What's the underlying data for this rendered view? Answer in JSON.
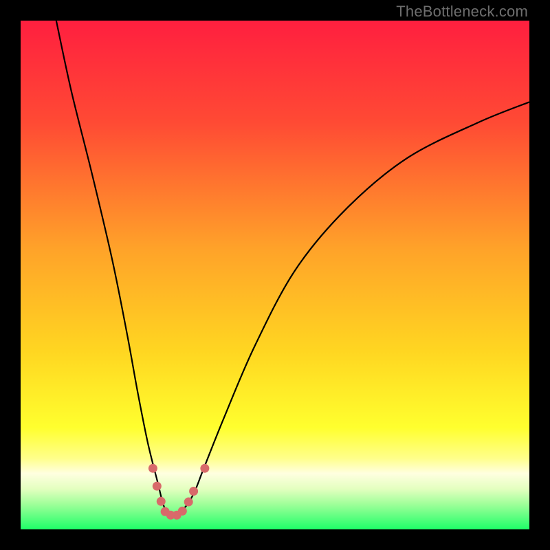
{
  "watermark": "TheBottleneck.com",
  "chart_data": {
    "type": "line",
    "title": "",
    "xlabel": "",
    "ylabel": "",
    "xlim": [
      0,
      100
    ],
    "ylim": [
      0,
      100
    ],
    "grid": false,
    "legend": false,
    "gradient_stops": [
      {
        "offset": 0.0,
        "color": "#ff1f3f"
      },
      {
        "offset": 0.2,
        "color": "#ff4a34"
      },
      {
        "offset": 0.45,
        "color": "#ffa329"
      },
      {
        "offset": 0.65,
        "color": "#ffd621"
      },
      {
        "offset": 0.8,
        "color": "#ffff2e"
      },
      {
        "offset": 0.86,
        "color": "#ffff8a"
      },
      {
        "offset": 0.89,
        "color": "#ffffe0"
      },
      {
        "offset": 0.92,
        "color": "#e4ffc0"
      },
      {
        "offset": 0.95,
        "color": "#a0ff9a"
      },
      {
        "offset": 1.0,
        "color": "#1eff68"
      }
    ],
    "series": [
      {
        "name": "bottleneck-curve",
        "x": [
          7,
          10,
          14,
          18,
          21,
          23,
          25,
          27,
          28,
          29,
          30,
          32,
          34,
          36,
          40,
          46,
          54,
          64,
          76,
          90,
          100
        ],
        "y": [
          100,
          86,
          70,
          53,
          38,
          27,
          17,
          9,
          5,
          3,
          3,
          4,
          7,
          12,
          22,
          36,
          51,
          63,
          73,
          80,
          84
        ]
      }
    ],
    "markers": {
      "name": "highlight-points",
      "color": "#d86a6a",
      "points": [
        {
          "x": 26.0,
          "y": 12.0
        },
        {
          "x": 26.8,
          "y": 8.5
        },
        {
          "x": 27.6,
          "y": 5.5
        },
        {
          "x": 28.4,
          "y": 3.5
        },
        {
          "x": 29.5,
          "y": 2.8
        },
        {
          "x": 30.7,
          "y": 2.8
        },
        {
          "x": 31.8,
          "y": 3.6
        },
        {
          "x": 33.0,
          "y": 5.4
        },
        {
          "x": 34.0,
          "y": 7.5
        },
        {
          "x": 36.2,
          "y": 12.0
        }
      ]
    }
  }
}
